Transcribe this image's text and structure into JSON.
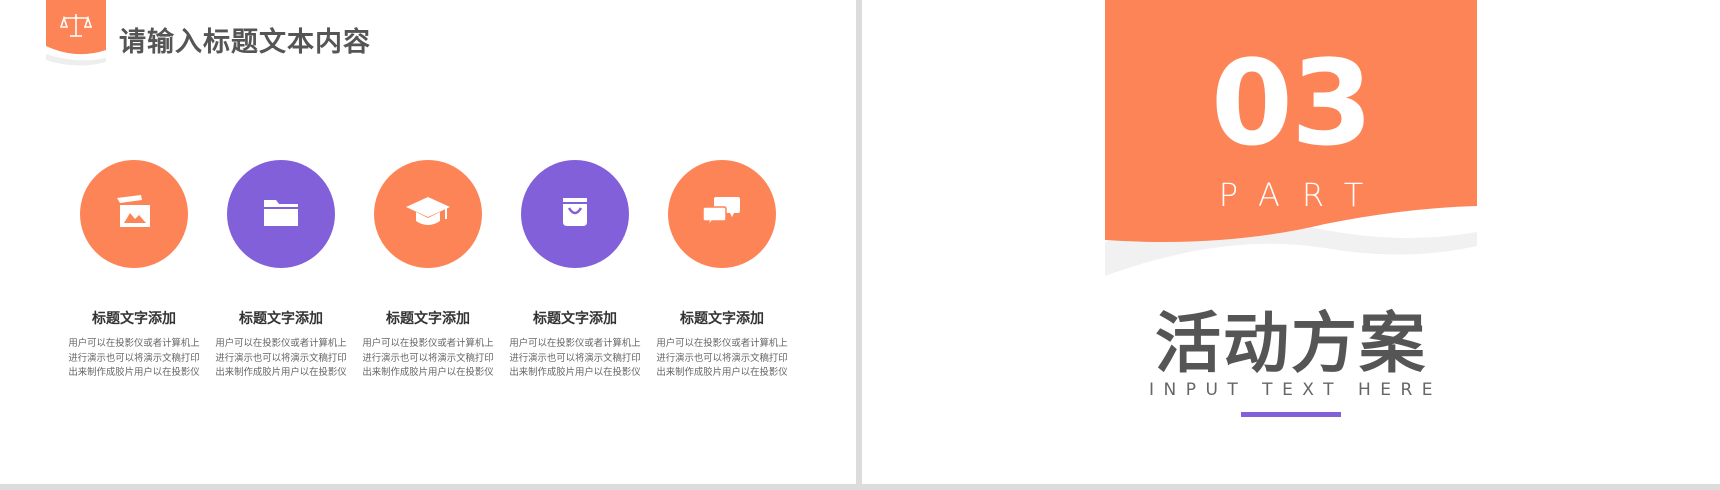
{
  "left_slide": {
    "header": {
      "title": "请输入标题文本内容",
      "badge_icon": "scales-icon",
      "badge_color": "#fd8456"
    },
    "items": [
      {
        "icon": "picture-icon",
        "color": "#fd8456",
        "title": "标题文字添加",
        "desc": "用户可以在投影仪或者计算机上进行演示也可以将演示文稿打印出来制作成胶片用户以在投影仪"
      },
      {
        "icon": "folder-icon",
        "color": "#8260d9",
        "title": "标题文字添加",
        "desc": "用户可以在投影仪或者计算机上进行演示也可以将演示文稿打印出来制作成胶片用户以在投影仪"
      },
      {
        "icon": "graduation-cap-icon",
        "color": "#fd8456",
        "title": "标题文字添加",
        "desc": "用户可以在投影仪或者计算机上进行演示也可以将演示文稿打印出来制作成胶片用户以在投影仪"
      },
      {
        "icon": "shopping-bag-icon",
        "color": "#8260d9",
        "title": "标题文字添加",
        "desc": "用户可以在投影仪或者计算机上进行演示也可以将演示文稿打印出来制作成胶片用户以在投影仪"
      },
      {
        "icon": "chat-bubbles-icon",
        "color": "#fd8456",
        "title": "标题文字添加",
        "desc": "用户可以在投影仪或者计算机上进行演示也可以将演示文稿打印出来制作成胶片用户以在投影仪"
      }
    ]
  },
  "right_slide": {
    "number": "03",
    "part_label": "PART",
    "title": "活动方案",
    "subtitle": "INPUT TEXT HERE",
    "colors": {
      "orange": "#fd8456",
      "purple": "#8260d9",
      "text": "#555555"
    }
  }
}
